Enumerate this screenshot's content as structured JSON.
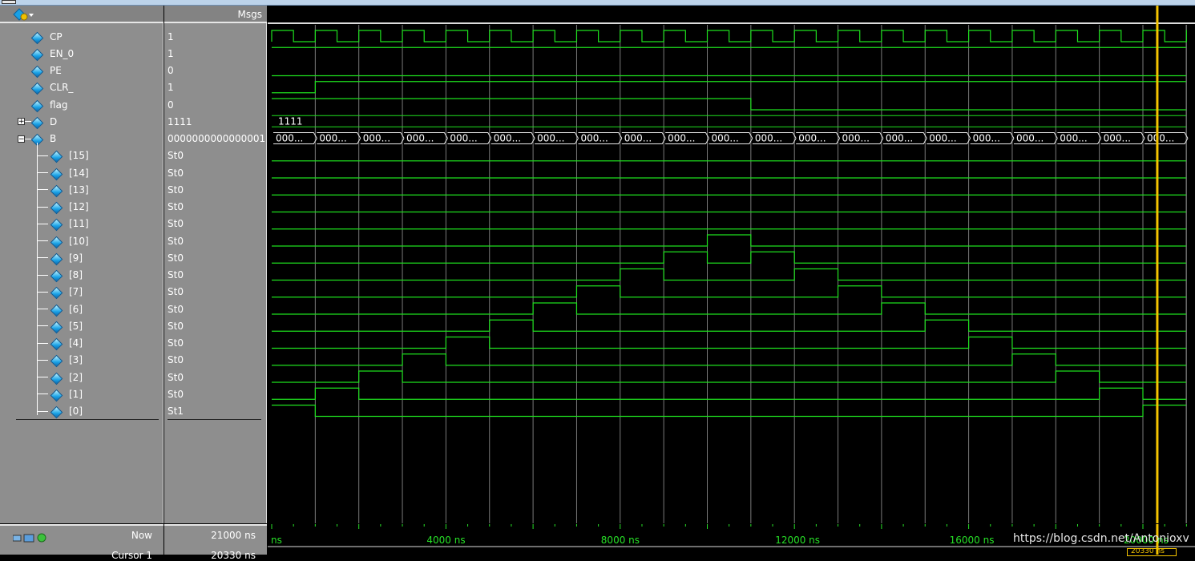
{
  "header": {
    "msgs_label": "Msgs"
  },
  "signals": [
    {
      "name": "CP",
      "value": "1",
      "expand": null,
      "indent": 0
    },
    {
      "name": "EN_0",
      "value": "1",
      "expand": null,
      "indent": 0
    },
    {
      "name": "PE",
      "value": "0",
      "expand": null,
      "indent": 0
    },
    {
      "name": "CLR_",
      "value": "1",
      "expand": null,
      "indent": 0
    },
    {
      "name": "flag",
      "value": "0",
      "expand": null,
      "indent": 0
    },
    {
      "name": "D",
      "value": "1111",
      "expand": "+",
      "indent": 0
    },
    {
      "name": "B",
      "value": "0000000000000001",
      "expand": "-",
      "indent": 0
    },
    {
      "name": "[15]",
      "value": "St0",
      "expand": null,
      "indent": 1
    },
    {
      "name": "[14]",
      "value": "St0",
      "expand": null,
      "indent": 1
    },
    {
      "name": "[13]",
      "value": "St0",
      "expand": null,
      "indent": 1
    },
    {
      "name": "[12]",
      "value": "St0",
      "expand": null,
      "indent": 1
    },
    {
      "name": "[11]",
      "value": "St0",
      "expand": null,
      "indent": 1
    },
    {
      "name": "[10]",
      "value": "St0",
      "expand": null,
      "indent": 1
    },
    {
      "name": "[9]",
      "value": "St0",
      "expand": null,
      "indent": 1
    },
    {
      "name": "[8]",
      "value": "St0",
      "expand": null,
      "indent": 1
    },
    {
      "name": "[7]",
      "value": "St0",
      "expand": null,
      "indent": 1
    },
    {
      "name": "[6]",
      "value": "St0",
      "expand": null,
      "indent": 1
    },
    {
      "name": "[5]",
      "value": "St0",
      "expand": null,
      "indent": 1
    },
    {
      "name": "[4]",
      "value": "St0",
      "expand": null,
      "indent": 1
    },
    {
      "name": "[3]",
      "value": "St0",
      "expand": null,
      "indent": 1
    },
    {
      "name": "[2]",
      "value": "St0",
      "expand": null,
      "indent": 1
    },
    {
      "name": "[1]",
      "value": "St0",
      "expand": null,
      "indent": 1
    },
    {
      "name": "[0]",
      "value": "St1",
      "expand": null,
      "indent": 1
    }
  ],
  "bus_labels": {
    "D": "1111",
    "B_segment": "000..."
  },
  "waveform": {
    "trace_color": "#1ee01e",
    "grid_color": "#7a7a7a",
    "cursor_color": "#f5c400",
    "clock_cycles": 21,
    "cursor_time_ns": 20330,
    "bit_sequence": [
      0,
      1,
      2,
      3,
      4,
      5,
      6,
      7,
      8,
      9,
      10,
      9,
      8,
      7,
      6,
      5,
      4,
      3,
      2,
      1,
      0
    ],
    "time_labels": [
      "ns",
      "4000 ns",
      "8000 ns",
      "12000 ns",
      "16000 ns",
      "20000 ns"
    ]
  },
  "footer": {
    "now_label": "Now",
    "now_value": "21000 ns",
    "cursor_label": "Cursor 1",
    "cursor_value": "20330 ns",
    "cursor_box": "20330 ns"
  },
  "watermark": "https://blog.csdn.net/Antonioxv"
}
